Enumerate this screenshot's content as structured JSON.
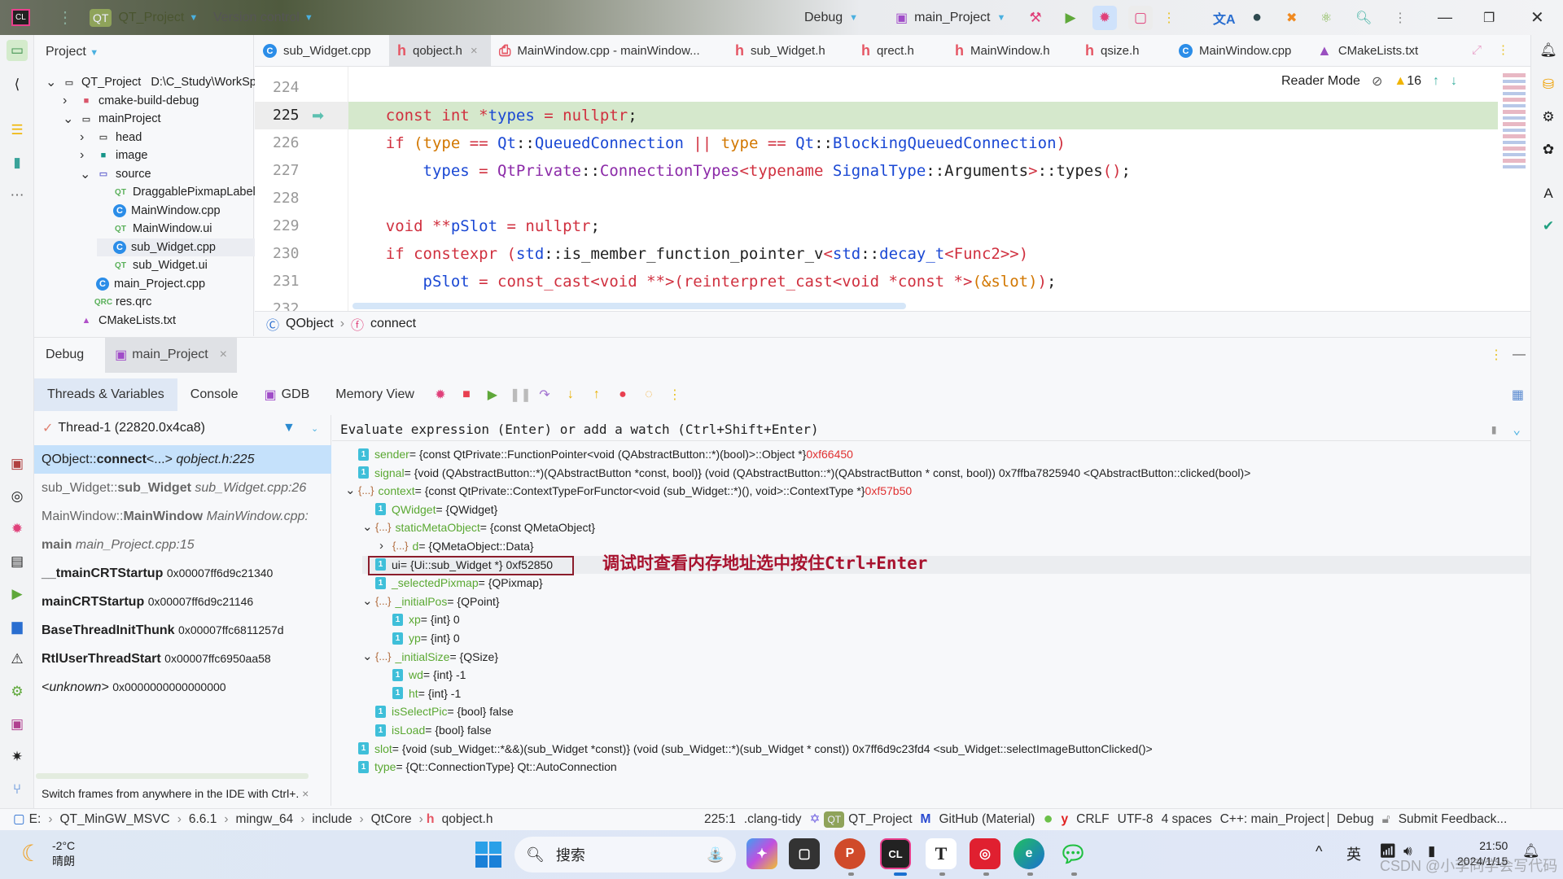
{
  "titlebar": {
    "project": "QT_Project",
    "vcs": "Version control",
    "config": "Debug",
    "run_target": "main_Project",
    "qt_badge": "QT"
  },
  "project_panel": {
    "title": "Project",
    "tree": [
      {
        "label": "QT_Project",
        "extra": "D:\\C_Study\\WorkSp",
        "indent": 0,
        "chev": "open",
        "icon": "folder-icon"
      },
      {
        "label": "cmake-build-debug",
        "indent": 1,
        "chev": "closed",
        "icon": "folder-red-icon"
      },
      {
        "label": "mainProject",
        "indent": 1,
        "chev": "open",
        "icon": "folder-icon"
      },
      {
        "label": "head",
        "indent": 2,
        "chev": "closed",
        "icon": "folder-icon"
      },
      {
        "label": "image",
        "indent": 2,
        "chev": "closed",
        "icon": "folder-image-icon"
      },
      {
        "label": "source",
        "indent": 2,
        "chev": "open",
        "icon": "folder-source-icon"
      },
      {
        "label": "DraggablePixmapLabel",
        "indent": 3,
        "icon": "qt-ui-icon"
      },
      {
        "label": "MainWindow.cpp",
        "indent": 3,
        "icon": "cpp-icon"
      },
      {
        "label": "MainWindow.ui",
        "indent": 3,
        "icon": "qt-ui-icon"
      },
      {
        "label": "sub_Widget.cpp",
        "indent": 3,
        "icon": "cpp-icon",
        "selected": true
      },
      {
        "label": "sub_Widget.ui",
        "indent": 3,
        "icon": "qt-ui-icon"
      },
      {
        "label": "main_Project.cpp",
        "indent": 2,
        "icon": "cpp-icon"
      },
      {
        "label": "res.qrc",
        "indent": 2,
        "icon": "qrc-icon"
      },
      {
        "label": "CMakeLists.txt",
        "indent": 1,
        "icon": "cmake-icon"
      }
    ]
  },
  "tabs": [
    {
      "label": "sub_Widget.cpp",
      "icon": "cpp"
    },
    {
      "label": "qobject.h",
      "icon": "h",
      "active": true,
      "closable": true
    },
    {
      "label": "MainWindow.cpp - mainWindow...",
      "icon": "pdf"
    },
    {
      "label": "sub_Widget.h",
      "icon": "h"
    },
    {
      "label": "qrect.h",
      "icon": "h"
    },
    {
      "label": "MainWindow.h",
      "icon": "h"
    },
    {
      "label": "qsize.h",
      "icon": "h"
    },
    {
      "label": "MainWindow.cpp",
      "icon": "cpp"
    },
    {
      "label": "CMakeLists.txt",
      "icon": "cmake"
    }
  ],
  "editor": {
    "reader_mode": "Reader Mode",
    "warnings": "16",
    "current_line": 225,
    "lines": [
      {
        "n": "224",
        "t": []
      },
      {
        "n": "225",
        "t": [
          [
            "    ",
            "d"
          ],
          [
            "const int ",
            "k"
          ],
          [
            "*",
            "k"
          ],
          [
            "types",
            "b"
          ],
          [
            " = ",
            "k"
          ],
          [
            "nullptr",
            "k"
          ],
          [
            ";",
            "d"
          ]
        ]
      },
      {
        "n": "226",
        "t": [
          [
            "    ",
            "d"
          ],
          [
            "if ",
            "k"
          ],
          [
            "(",
            "o"
          ],
          [
            "type",
            "o"
          ],
          [
            " == ",
            "k"
          ],
          [
            "Qt",
            "b"
          ],
          [
            "::",
            "d"
          ],
          [
            "QueuedConnection",
            "b"
          ],
          [
            " || ",
            "k"
          ],
          [
            "type",
            "o"
          ],
          [
            " == ",
            "k"
          ],
          [
            "Qt",
            "b"
          ],
          [
            "::",
            "d"
          ],
          [
            "BlockingQueuedConnection",
            "b"
          ],
          [
            ")",
            "k"
          ]
        ]
      },
      {
        "n": "227",
        "t": [
          [
            "        ",
            "d"
          ],
          [
            "types",
            "b"
          ],
          [
            " = ",
            "k"
          ],
          [
            "QtPrivate",
            "p"
          ],
          [
            "::",
            "d"
          ],
          [
            "ConnectionTypes",
            "p"
          ],
          [
            "<typename ",
            "k"
          ],
          [
            "SignalType",
            "b"
          ],
          [
            "::",
            "d"
          ],
          [
            "Arguments",
            "d"
          ],
          [
            ">",
            "k"
          ],
          [
            "::",
            "d"
          ],
          [
            "types",
            "d"
          ],
          [
            "()",
            "k"
          ],
          [
            ";",
            "d"
          ]
        ]
      },
      {
        "n": "228",
        "t": []
      },
      {
        "n": "229",
        "t": [
          [
            "    ",
            "d"
          ],
          [
            "void ",
            "k"
          ],
          [
            "**",
            "k"
          ],
          [
            "pSlot",
            "b"
          ],
          [
            " = ",
            "k"
          ],
          [
            "nullptr",
            "k"
          ],
          [
            ";",
            "d"
          ]
        ]
      },
      {
        "n": "230",
        "t": [
          [
            "    ",
            "d"
          ],
          [
            "if constexpr ",
            "k"
          ],
          [
            "(",
            "k"
          ],
          [
            "std",
            "b"
          ],
          [
            "::",
            "d"
          ],
          [
            "is_member_function_pointer_v",
            "d"
          ],
          [
            "<",
            "k"
          ],
          [
            "std",
            "b"
          ],
          [
            "::",
            "d"
          ],
          [
            "decay_t",
            "b"
          ],
          [
            "<Func2>>",
            "k"
          ],
          [
            ")",
            "k"
          ]
        ]
      },
      {
        "n": "231",
        "t": [
          [
            "        ",
            "d"
          ],
          [
            "pSlot",
            "b"
          ],
          [
            " = ",
            "k"
          ],
          [
            "const_cast<void **>(reinterpret_cast<void *const *>",
            "k"
          ],
          [
            "(&slot)",
            "o"
          ],
          [
            ")",
            "k"
          ],
          [
            ";",
            "d"
          ]
        ]
      },
      {
        "n": "232",
        "t": []
      }
    ]
  },
  "breadcrumb": {
    "class": "QObject",
    "function": "connect"
  },
  "debug": {
    "tab_title": "Debug",
    "session": "main_Project",
    "subtabs": [
      "Threads & Variables",
      "Console",
      "GDB",
      "Memory View"
    ],
    "thread": "Thread-1 (22820.0x4ca8)",
    "eval_placeholder": "Evaluate expression (Enter) or add a watch (Ctrl+Shift+Enter)",
    "frames": [
      {
        "pre": "QObject::",
        "name": "connect",
        "post": "<...> ",
        "loc": "qobject.h:225",
        "style": "italic"
      },
      {
        "pre": "sub_Widget::",
        "name": "sub_Widget",
        "post": " ",
        "loc": "sub_Widget.cpp:26",
        "style": "italic"
      },
      {
        "pre": "MainWindow::",
        "name": "MainWindow",
        "post": " ",
        "loc": "MainWindow.cpp:",
        "style": "italic"
      },
      {
        "pre": "",
        "name": "main",
        "post": " ",
        "loc": "main_Project.cpp:15",
        "style": "italic"
      },
      {
        "pre": "",
        "name": "__tmainCRTStartup",
        "post": " ",
        "loc": "0x00007ff6d9c21340",
        "style": "addr"
      },
      {
        "pre": "",
        "name": "mainCRTStartup",
        "post": " ",
        "loc": "0x00007ff6d9c21146",
        "style": "addr"
      },
      {
        "pre": "",
        "name": "BaseThreadInitThunk",
        "post": " ",
        "loc": "0x00007ffc6811257d",
        "style": "addr"
      },
      {
        "pre": "",
        "name": "RtlUserThreadStart",
        "post": " ",
        "loc": "0x00007ffc6950aa58",
        "style": "addr"
      },
      {
        "pre": "",
        "name": "",
        "post": "<unknown> ",
        "loc": "0x0000000000000000",
        "style": "addr"
      }
    ],
    "variables": [
      {
        "lvl": 0,
        "kind": "prim",
        "name": "sender",
        "value": " = {const QtPrivate::FunctionPointer<void (QAbstractButton::*)(bool)>::Object *} ",
        "addr": "0xf66450"
      },
      {
        "lvl": 0,
        "kind": "prim",
        "name": "signal",
        "value": " = {void (QAbstractButton::*)(QAbstractButton *const, bool)} (void (QAbstractButton::*)(QAbstractButton * const, bool)) 0x7ffba7825940 <QAbstractButton::clicked(bool)>"
      },
      {
        "lvl": 0,
        "kind": "obj",
        "exp": "open",
        "name": "context",
        "value": " = {const QtPrivate::ContextTypeForFunctor<void (sub_Widget::*)(), void>::ContextType *} ",
        "addr": "0xf57b50"
      },
      {
        "lvl": 1,
        "kind": "prim",
        "name": "QWidget",
        "value": " = {QWidget}"
      },
      {
        "lvl": 1,
        "kind": "obj",
        "exp": "open",
        "name": "staticMetaObject",
        "value": " = {const QMetaObject}"
      },
      {
        "lvl": 2,
        "kind": "obj",
        "exp": "closed",
        "name": "d",
        "value": " = {QMetaObject::Data}"
      },
      {
        "lvl": 1,
        "kind": "prim",
        "name": "ui",
        "value": " = {Ui::sub_Widget *} 0xf52850",
        "selected": true,
        "namecolor": "dark"
      },
      {
        "lvl": 1,
        "kind": "prim",
        "name": "_selectedPixmap",
        "value": " = {QPixmap}"
      },
      {
        "lvl": 1,
        "kind": "obj",
        "exp": "open",
        "name": "_initialPos",
        "value": " = {QPoint}"
      },
      {
        "lvl": 2,
        "kind": "prim",
        "name": "xp",
        "value": " = {int} 0"
      },
      {
        "lvl": 2,
        "kind": "prim",
        "name": "yp",
        "value": " = {int} 0"
      },
      {
        "lvl": 1,
        "kind": "obj",
        "exp": "open",
        "name": "_initialSize",
        "value": " = {QSize}"
      },
      {
        "lvl": 2,
        "kind": "prim",
        "name": "wd",
        "value": " = {int} -1"
      },
      {
        "lvl": 2,
        "kind": "prim",
        "name": "ht",
        "value": " = {int} -1"
      },
      {
        "lvl": 1,
        "kind": "prim",
        "name": "isSelectPic",
        "value": " = {bool} false"
      },
      {
        "lvl": 1,
        "kind": "prim",
        "name": "isLoad",
        "value": " = {bool} false"
      },
      {
        "lvl": 0,
        "kind": "prim",
        "name": "slot",
        "value": " = {void (sub_Widget::*&&)(sub_Widget *const)} (void (sub_Widget::*)(sub_Widget * const)) 0x7ff6d9c23fd4 <sub_Widget::selectImageButtonClicked()>"
      },
      {
        "lvl": 0,
        "kind": "prim",
        "name": "type",
        "value": " = {Qt::ConnectionType} Qt::AutoConnection"
      }
    ],
    "annotation": "调试时查看内存地址选中按住Ctrl+Enter",
    "tip": "Switch frames from anywhere in the IDE with Ctrl+."
  },
  "statusbar": {
    "path": [
      "E:",
      "QT_MinGW_MSVC",
      "6.6.1",
      "mingw_64",
      "include",
      "QtCore",
      "qobject.h"
    ],
    "position": "225:1",
    "linter": ".clang-tidy",
    "project": "QT_Project",
    "theme": "GitHub (Material)",
    "line_sep": "CRLF",
    "encoding": "UTF-8",
    "indent": "4 spaces",
    "context": "C++: main_Project",
    "config": "Debug",
    "feedback": "Submit Feedback..."
  },
  "taskbar": {
    "temperature": "-2°C",
    "weather": "晴朗",
    "search": "搜索",
    "ime": "英",
    "time": "21:50",
    "date": "2024/1/15",
    "watermark": "CSDN @小李同学会写代码"
  }
}
